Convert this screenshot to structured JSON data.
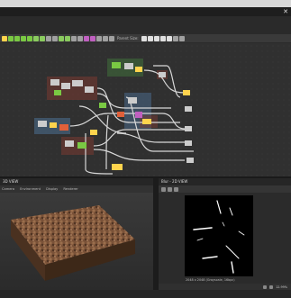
{
  "toolbar": {
    "parent_size_label": "Parent Size:",
    "buttons": [
      "#ffd34d",
      "#7ac943",
      "#7ac943",
      "#7ac943",
      "#7ac943",
      "#8acb5f",
      "#8acb5f",
      "#a0a0a0",
      "#a0a0a0",
      "#8acb5f",
      "#8acb5f",
      "#a0a0a0",
      "#a0a0a0",
      "#c060c0",
      "#c060c0",
      "#a0a0a0",
      "#a0a0a0",
      "#a0a0a0",
      "#e0e0e0",
      "#e0e0e0",
      "#e0e0e0",
      "#e0e0e0",
      "#e0e0e0",
      "#a0a0a0",
      "#a0a0a0"
    ]
  },
  "panel_3d": {
    "title": "3D VIEW",
    "tabs": [
      "Camera",
      "Environment",
      "Display",
      "Renderer"
    ]
  },
  "panel_2d": {
    "title": "Blur - 2D VIEW",
    "caption": "2048 x 2048 (Grayscale, 16bpc)",
    "zoom": "12.99%"
  },
  "colors": {
    "graph_bg": "#303030",
    "node_green": "#7ac943",
    "wire": "#d8d8d8",
    "frame_red": "#7a3a32",
    "frame_blue": "#4a6a8a",
    "frame_green": "#3f6a3a"
  }
}
